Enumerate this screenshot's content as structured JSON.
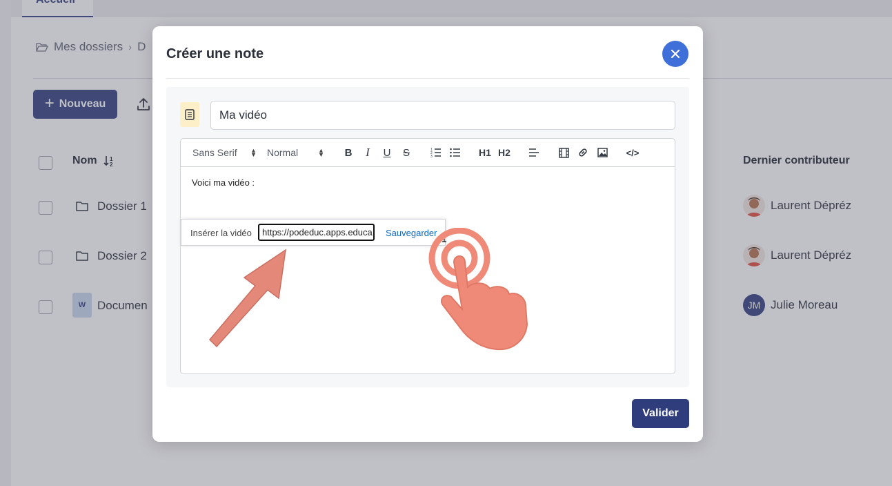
{
  "colors": {
    "primary": "#2f3d7c",
    "close_button": "#3f6fd8",
    "annotation": "#f08a78",
    "link": "#0a66c2"
  },
  "app": {
    "tab_active_label": "Accueil",
    "breadcrumb": {
      "root": "Mes dossiers",
      "current": "D"
    },
    "new_button_label": "Nouveau",
    "table": {
      "col_name": "Nom",
      "col_contributor": "Dernier contributeur",
      "rows": [
        {
          "type": "folder",
          "name": "Dossier 1",
          "contributor": "Laurent Dépréz"
        },
        {
          "type": "folder",
          "name": "Dossier 2",
          "contributor": "Laurent Dépréz"
        },
        {
          "type": "document",
          "icon_letter": "W",
          "name": "Documen",
          "contributor": "Julie Moreau",
          "avatar_initials": "JM"
        }
      ]
    }
  },
  "modal": {
    "title": "Créer une note",
    "note_title_value": "Ma vidéo",
    "toolbar": {
      "font_select": "Sans Serif",
      "size_select": "Normal",
      "bold": "B",
      "italic": "I",
      "underline": "U",
      "strike": "S",
      "h1": "H1",
      "h2": "H2",
      "code_icon": "</>"
    },
    "editor_text": "Voici ma vidéo :",
    "video_tooltip": {
      "label": "Insérer la vidéo",
      "input_value": "https://podeduc.apps.educa",
      "save_label": "Sauvegarder"
    },
    "validate_label": "Valider"
  }
}
